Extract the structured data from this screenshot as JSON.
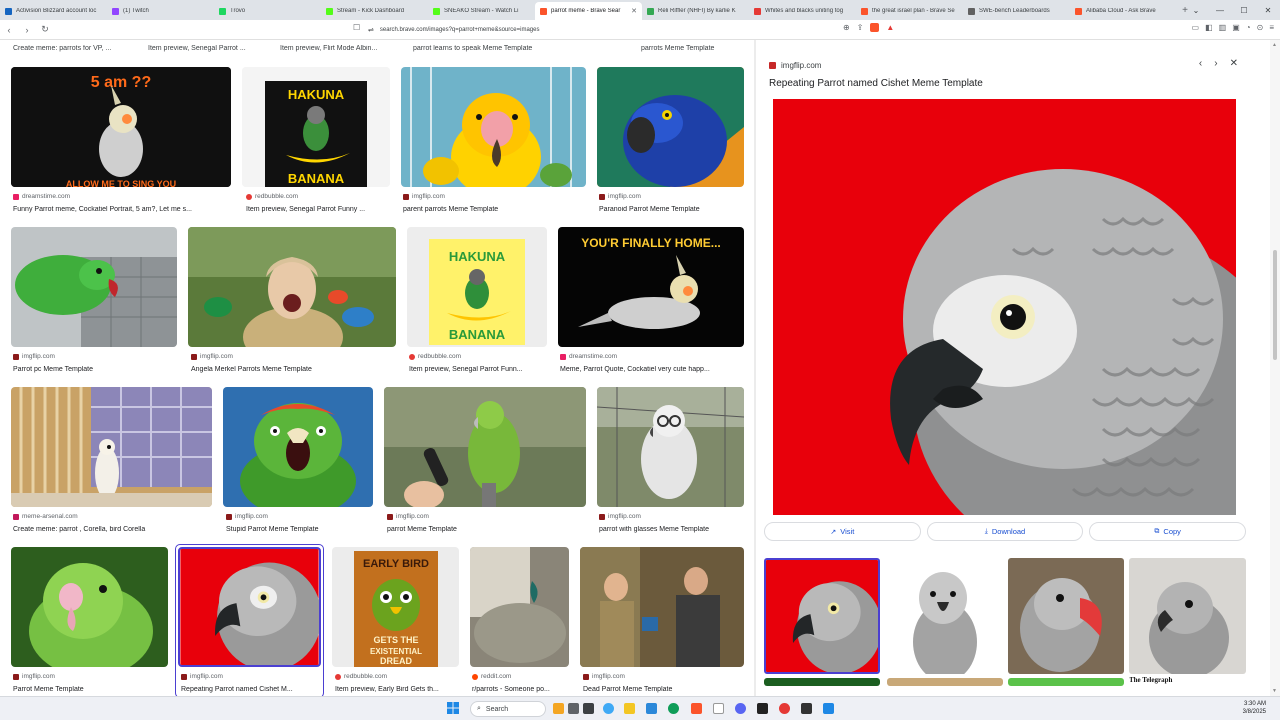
{
  "browser": {
    "tabs": [
      {
        "label": "Activision Blizzard account loc",
        "color": "#1565c0"
      },
      {
        "label": "(1) Twitch",
        "color": "#9146ff"
      },
      {
        "label": "Trovo",
        "color": "#1ed760"
      },
      {
        "label": "Stream - Kick Dashboard",
        "color": "#53fc18"
      },
      {
        "label": "SNEAKO Stream - Watch Li",
        "color": "#53fc18"
      },
      {
        "label": "parrot meme - Brave Sear",
        "color": "#fb542b",
        "active": true
      },
      {
        "label": "Reli Riffler (NHFI) By karlie K",
        "color": "#34a853"
      },
      {
        "label": "Whites and blacks uniting tog",
        "color": "#e53935"
      },
      {
        "label": "the great israel plan - Brave Se",
        "color": "#fb542b"
      },
      {
        "label": "SWE-bench Leaderboards",
        "color": "#616161"
      },
      {
        "label": "Alibaba Cloud - Ask Brave",
        "color": "#fb542b"
      }
    ],
    "url": "search.brave.com/images?q=parrot+meme&source=images"
  },
  "grid": {
    "partial_row": [
      "Create meme: parrots for VP, ...",
      "Item preview, Senegal Parrot ...",
      "Item preview, Flirt Mode Albin...",
      "parrot learns to speak Meme Template",
      "parrots Meme Template"
    ],
    "rows": [
      [
        {
          "source": "dreamstime.com",
          "caption": "Funny Parrot meme, Cockatiel Portrait, 5 am?, Let me s...",
          "overlay_top": "5 am ??",
          "overlay_bottom": "ALLOW ME TO SING YOU",
          "icon": "#e91e63"
        },
        {
          "source": "redbubble.com",
          "caption": "Item preview, Senegal Parrot Funny ...",
          "overlay_top": "HAKUNA",
          "overlay_bottom": "BANANA",
          "icon": "#e53935"
        },
        {
          "source": "imgflip.com",
          "caption": "parent parrots Meme Template",
          "icon": "#8b1a1a"
        },
        {
          "source": "imgflip.com",
          "caption": "Paranoid Parrot Meme Template",
          "icon": "#8b1a1a"
        }
      ],
      [
        {
          "source": "imgflip.com",
          "caption": "Parrot pc Meme Template",
          "icon": "#8b1a1a"
        },
        {
          "source": "imgflip.com",
          "caption": "Angela Merkel Parrots Meme Template",
          "icon": "#8b1a1a"
        },
        {
          "source": "redbubble.com",
          "caption": "Item preview, Senegal Parrot Funn...",
          "overlay_top": "HAKUNA",
          "overlay_bottom": "BANANA",
          "icon": "#e53935"
        },
        {
          "source": "dreamstime.com",
          "caption": "Meme, Parrot Quote, Cockatiel very cute happ...",
          "overlay_top": "YOU'R FINALLY HOME...",
          "icon": "#e91e63"
        }
      ],
      [
        {
          "source": "meme-arsenal.com",
          "caption": "Create meme: parrot , Corella, bird Corella",
          "icon": "#c2185b"
        },
        {
          "source": "imgflip.com",
          "caption": "Stupid Parrot Meme Template",
          "icon": "#8b1a1a"
        },
        {
          "source": "imgflip.com",
          "caption": "parrot Meme Template",
          "icon": "#8b1a1a"
        },
        {
          "source": "imgflip.com",
          "caption": "parrot with glasses Meme Template",
          "icon": "#8b1a1a"
        }
      ],
      [
        {
          "source": "imgflip.com",
          "caption": "Parrot Meme Template",
          "icon": "#8b1a1a"
        },
        {
          "source": "imgflip.com",
          "caption": "Repeating Parrot named Cishet M...",
          "icon": "#8b1a1a"
        },
        {
          "source": "redbubble.com",
          "caption": "Item preview, Early Bird Gets th...",
          "overlay_top": "EARLY BIRD",
          "overlay_bottom": "GETS THE EXISTENTIAL DREAD",
          "icon": "#e53935"
        },
        {
          "source": "reddit.com",
          "caption": "r/parrots - Someone po...",
          "icon": "#ff4500"
        },
        {
          "source": "imgflip.com",
          "caption": "Dead Parrot Meme Template",
          "icon": "#8b1a1a"
        }
      ]
    ]
  },
  "preview": {
    "source": "imgflip.com",
    "title": "Repeating Parrot named Cishet Meme Template",
    "actions": {
      "visit": "Visit",
      "download": "Download",
      "copy": "Copy"
    },
    "related_bottom_text": "The Telegraph"
  },
  "taskbar": {
    "search_placeholder": "Search",
    "time": "3:30 AM",
    "date": "3/8/2025"
  },
  "colors": {
    "accent": "#4b3fd1",
    "link": "#1a4fd1",
    "parrot_bg": "#e8000b"
  }
}
